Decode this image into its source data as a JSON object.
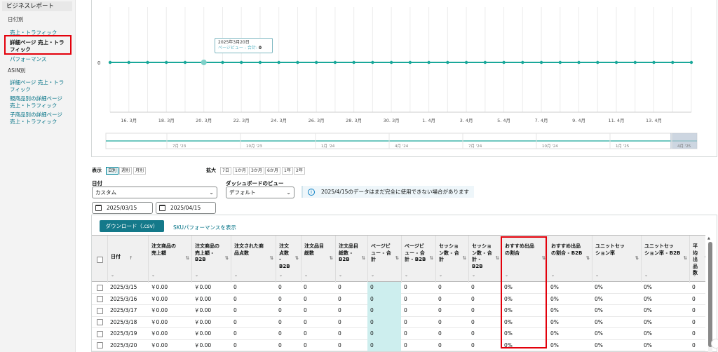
{
  "sidebar": {
    "header": "ビジネスレポート",
    "section_date": "日付別",
    "date_items": [
      "売上・トラフィック",
      "詳細ページ 売上・トラ",
      "フィック",
      "パフォーマンス"
    ],
    "section_asin": "ASIN別",
    "asin_items": [
      [
        "詳細ページ 売上・トラ",
        "フィック"
      ],
      [
        "親商品別の詳細ページ",
        "売上・トラフィック"
      ],
      [
        "子商品別の詳細ページ",
        "売上・トラフィック"
      ]
    ]
  },
  "chart": {
    "y_label": "0",
    "x_ticks": [
      "16. 3月",
      "18. 3月",
      "20. 3月",
      "22. 3月",
      "24. 3月",
      "26. 3月",
      "28. 3月",
      "30. 3月",
      "1. 4月",
      "3. 4月",
      "5. 4月",
      "7. 4月",
      "9. 4月",
      "11. 4月",
      "13. 4月"
    ],
    "nav_ticks": [
      "7月 '23",
      "10月 '23",
      "1月 '24",
      "4月 '24",
      "7月 '24",
      "10月 '24",
      "1月 '25",
      "4月 '25"
    ],
    "tooltip": {
      "date": "2025年3月20日",
      "label": "ページビュー - 合計:",
      "value": "0"
    },
    "line_color": "#1aa89a"
  },
  "chart_data": {
    "type": "line",
    "x": [
      "2025/3/15",
      "2025/3/16",
      "2025/3/17",
      "2025/3/18",
      "2025/3/19",
      "2025/3/20",
      "2025/3/21",
      "2025/3/22",
      "2025/3/23",
      "2025/3/24",
      "2025/3/25",
      "2025/3/26",
      "2025/3/27",
      "2025/3/28",
      "2025/3/29",
      "2025/3/30",
      "2025/3/31",
      "2025/4/1",
      "2025/4/2",
      "2025/4/3",
      "2025/4/4",
      "2025/4/5",
      "2025/4/6",
      "2025/4/7",
      "2025/4/8",
      "2025/4/9",
      "2025/4/10",
      "2025/4/11",
      "2025/4/12",
      "2025/4/13",
      "2025/4/14",
      "2025/4/15"
    ],
    "series": [
      {
        "values": [
          0,
          0,
          0,
          0,
          0,
          0,
          0,
          0,
          0,
          0,
          0,
          0,
          0,
          0,
          0,
          0,
          0,
          0,
          0,
          0,
          0,
          0,
          0,
          0,
          0,
          0,
          0,
          0,
          0,
          0,
          0,
          0
        ]
      }
    ],
    "grid": true
  },
  "controls": {
    "view_label": "表示",
    "view_opts": [
      "日別",
      "週別",
      "月別"
    ],
    "zoom_label": "拡大",
    "zoom_opts": [
      "7日",
      "1か月",
      "3か月",
      "6か月",
      "1年",
      "2年"
    ],
    "date_label": "日付",
    "date_value": "カスタム",
    "dash_label": "ダッシュボードのビュー",
    "dash_value": "デフォルト",
    "info_text": "2025/4/15のデータはまだ完全に使用できない場合があります",
    "start_date": "2025/03/15",
    "end_date": "2025/04/15",
    "download": "ダウンロード（.csv）",
    "sku_link": "SKUパフォーマンスを表示"
  },
  "table": {
    "headers": [
      [
        "日付"
      ],
      [
        "注文商品の",
        "売上額"
      ],
      [
        "注文商品の",
        "売上額 -",
        "B2B"
      ],
      [
        "注文された商",
        "品点数"
      ],
      [
        "注文",
        "点数 -",
        "B2B"
      ],
      [
        "注文品目",
        "総数"
      ],
      [
        "注文品目",
        "総数 -",
        "B2B"
      ],
      [
        "ページビ",
        "ュー - 合",
        "計"
      ],
      [
        "ページビ",
        "ュー - 合",
        "計 - B2B"
      ],
      [
        "セッショ",
        "ン数 - 合",
        "計"
      ],
      [
        "セッショ",
        "ン数 - 合",
        "計 - B2B"
      ],
      [
        "おすすめ出品",
        "の割合"
      ],
      [
        "おすすめ出品",
        "の割合 - B2B"
      ],
      [
        "ユニットセッ",
        "ション率"
      ],
      [
        "ユニットセッ",
        "ション率 - B2B"
      ],
      [
        "平均出",
        "品数"
      ]
    ],
    "rows": [
      [
        "2025/3/15",
        "￥0.00",
        "￥0.00",
        "0",
        "0",
        "0",
        "0",
        "0",
        "0",
        "0",
        "0",
        "0%",
        "0%",
        "0%",
        "0%",
        "0"
      ],
      [
        "2025/3/16",
        "￥0.00",
        "￥0.00",
        "0",
        "0",
        "0",
        "0",
        "0",
        "0",
        "0",
        "0",
        "0%",
        "0%",
        "0%",
        "0%",
        "0"
      ],
      [
        "2025/3/17",
        "￥0.00",
        "￥0.00",
        "0",
        "0",
        "0",
        "0",
        "0",
        "0",
        "0",
        "0",
        "0%",
        "0%",
        "0%",
        "0%",
        "0"
      ],
      [
        "2025/3/18",
        "￥0.00",
        "￥0.00",
        "0",
        "0",
        "0",
        "0",
        "0",
        "0",
        "0",
        "0",
        "0%",
        "0%",
        "0%",
        "0%",
        "0"
      ],
      [
        "2025/3/19",
        "￥0.00",
        "￥0.00",
        "0",
        "0",
        "0",
        "0",
        "0",
        "0",
        "0",
        "0",
        "0%",
        "0%",
        "0%",
        "0%",
        "0"
      ],
      [
        "2025/3/20",
        "￥0.00",
        "￥0.00",
        "0",
        "0",
        "0",
        "0",
        "0",
        "0",
        "0",
        "0",
        "0%",
        "0%",
        "0%",
        "0%",
        "0"
      ]
    ]
  }
}
